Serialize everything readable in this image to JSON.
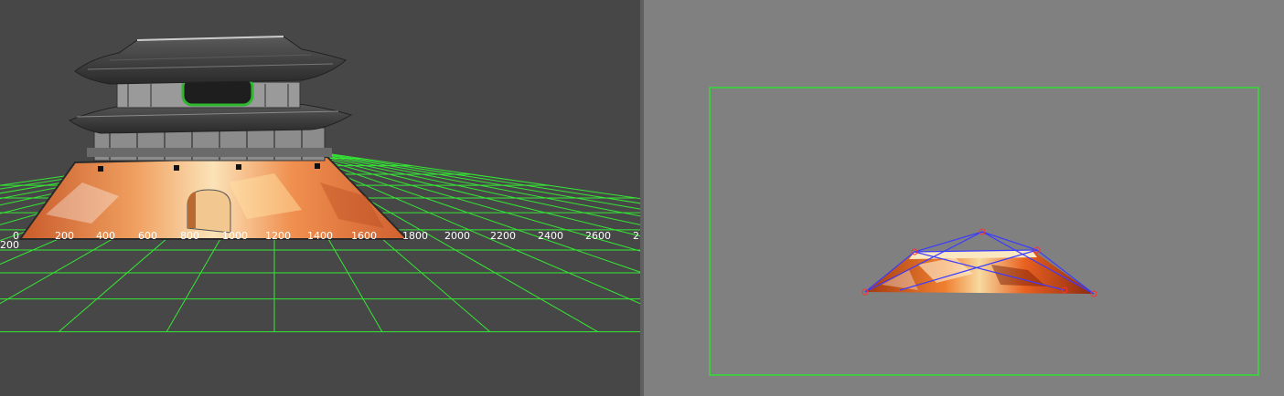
{
  "viewport_3d": {
    "grid_color": "#34e834",
    "x_axis_ticks": [
      "0",
      "200",
      "400",
      "600",
      "800",
      "1000",
      "1200",
      "1400",
      "1600",
      "1800",
      "2000",
      "2200",
      "2400",
      "2600",
      "2"
    ],
    "z_axis_label": "200"
  },
  "viewport_uv": {
    "frame_color": "#33dd33",
    "cage_line_color": "#3b3bff",
    "cage_point_color": "#ff3030"
  },
  "palette": {
    "roof_dark": "#3c3c3c",
    "roof_mid": "#6e6e6e",
    "wall_light": "#9a9a9a",
    "texture_orange": "#e06a20",
    "texture_light": "#f6d9a8"
  }
}
